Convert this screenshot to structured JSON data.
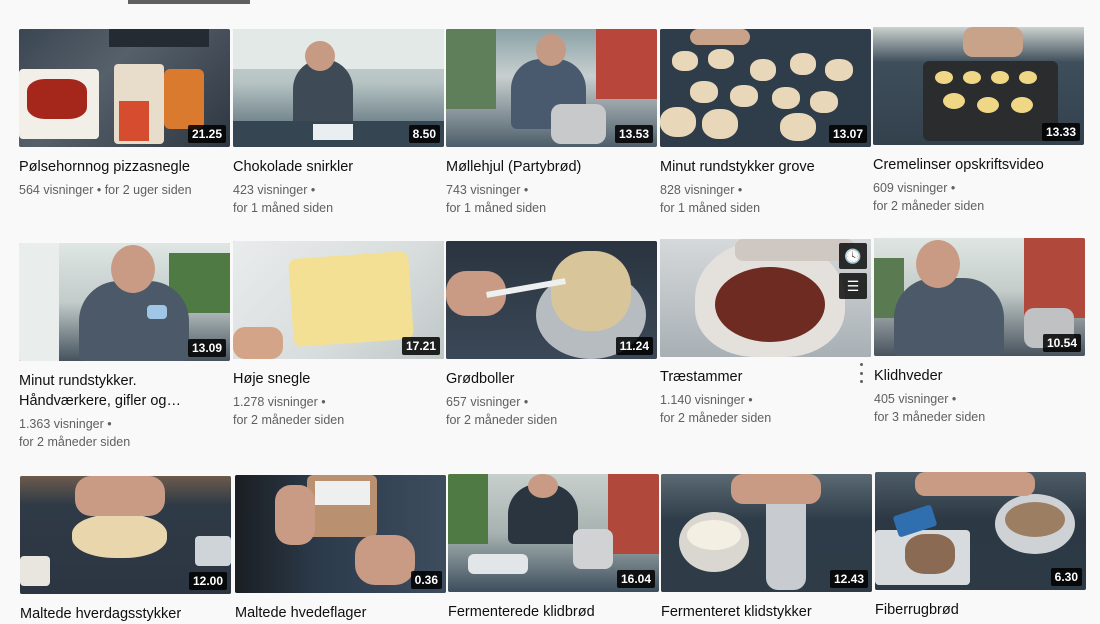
{
  "rows": [
    [
      {
        "title": "Pølsehornnog pizzasnegle",
        "views": "564 visninger",
        "age": "for 2 uger siden",
        "duration": "21.25"
      },
      {
        "title": "Chokolade snirkler",
        "views": "423 visninger",
        "age": "for 1 måned siden",
        "duration": "8.50"
      },
      {
        "title": "Møllehjul (Partybrød)",
        "views": "743 visninger",
        "age": "for 1 måned siden",
        "duration": "13.53"
      },
      {
        "title": "Minut rundstykker grove",
        "views": "828 visninger",
        "age": "for 1 måned siden",
        "duration": "13.07"
      },
      {
        "title": "Cremelinser opskriftsvideo",
        "views": "609 visninger",
        "age": "for 2 måneder siden",
        "duration": "13.33"
      }
    ],
    [
      {
        "title": "Minut rundstykker. Håndværkere, gifler og…",
        "views": "1.363 visninger",
        "age": "for 2 måneder siden",
        "duration": "13.09"
      },
      {
        "title": "Høje snegle",
        "views": "1.278 visninger",
        "age": "for 2 måneder siden",
        "duration": "17.21"
      },
      {
        "title": "Grødboller",
        "views": "657 visninger",
        "age": "for 2 måneder siden",
        "duration": "11.24"
      },
      {
        "title": "Træstammer",
        "views": "1.140 visninger",
        "age": "for 2 måneder siden",
        "duration": ""
      },
      {
        "title": "Klidhveder",
        "views": "405 visninger",
        "age": "for 3 måneder siden",
        "duration": "10.54"
      }
    ],
    [
      {
        "title": "Maltede hverdagsstykker",
        "views": "",
        "age": "",
        "duration": "12.00"
      },
      {
        "title": "Maltede hvedeflager",
        "views": "",
        "age": "",
        "duration": "0.36"
      },
      {
        "title": "Fermenterede klidbrød",
        "views": "",
        "age": "",
        "duration": "16.04"
      },
      {
        "title": "Fermenteret klidstykker",
        "views": "",
        "age": "",
        "duration": "12.43"
      },
      {
        "title": "Fiberrugbrød",
        "views": "",
        "age": "",
        "duration": "6.30"
      }
    ]
  ],
  "separator": " • ",
  "icons": {
    "watch_later": "clock-icon",
    "add_to_queue": "queue-icon",
    "more": "more-vertical-icon"
  },
  "colors": {
    "text": "#0f0f0f",
    "meta": "#606060",
    "background": "#f9f9f9",
    "badge": "#000000"
  }
}
